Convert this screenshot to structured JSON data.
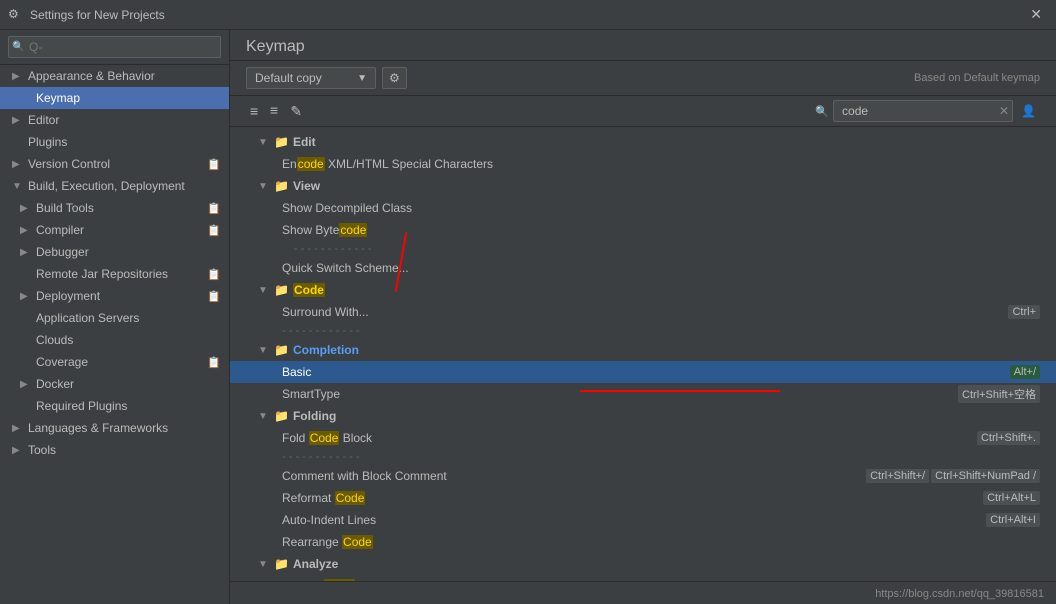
{
  "titleBar": {
    "icon": "⚙",
    "title": "Settings for New Projects",
    "closeLabel": "✕"
  },
  "sidebar": {
    "searchPlaceholder": "Q-",
    "items": [
      {
        "id": "appearance",
        "label": "Appearance & Behavior",
        "indent": 0,
        "type": "section",
        "arrow": "▶",
        "hasArrow": true
      },
      {
        "id": "keymap",
        "label": "Keymap",
        "indent": 1,
        "type": "item",
        "active": true
      },
      {
        "id": "editor",
        "label": "Editor",
        "indent": 0,
        "type": "section",
        "arrow": "▶",
        "hasArrow": true
      },
      {
        "id": "plugins",
        "label": "Plugins",
        "indent": 0,
        "type": "item"
      },
      {
        "id": "version-control",
        "label": "Version Control",
        "indent": 0,
        "type": "section",
        "arrow": "▶",
        "hasArrow": true,
        "hasCopyIcon": true
      },
      {
        "id": "build-execution",
        "label": "Build, Execution, Deployment",
        "indent": 0,
        "type": "section",
        "arrow": "▼",
        "hasArrow": true
      },
      {
        "id": "build-tools",
        "label": "Build Tools",
        "indent": 1,
        "type": "section",
        "arrow": "▶",
        "hasArrow": true,
        "hasCopyIcon": true
      },
      {
        "id": "compiler",
        "label": "Compiler",
        "indent": 1,
        "type": "section",
        "arrow": "▶",
        "hasArrow": true,
        "hasCopyIcon": true
      },
      {
        "id": "debugger",
        "label": "Debugger",
        "indent": 1,
        "type": "section",
        "arrow": "▶",
        "hasArrow": true
      },
      {
        "id": "remote-jar",
        "label": "Remote Jar Repositories",
        "indent": 1,
        "type": "item",
        "hasCopyIcon": true
      },
      {
        "id": "deployment",
        "label": "Deployment",
        "indent": 1,
        "type": "section",
        "arrow": "▶",
        "hasArrow": true,
        "hasCopyIcon": true
      },
      {
        "id": "app-servers",
        "label": "Application Servers",
        "indent": 1,
        "type": "item"
      },
      {
        "id": "clouds",
        "label": "Clouds",
        "indent": 1,
        "type": "item"
      },
      {
        "id": "coverage",
        "label": "Coverage",
        "indent": 1,
        "type": "item",
        "hasCopyIcon": true
      },
      {
        "id": "docker",
        "label": "Docker",
        "indent": 1,
        "type": "section",
        "arrow": "▶",
        "hasArrow": true
      },
      {
        "id": "required-plugins",
        "label": "Required Plugins",
        "indent": 1,
        "type": "item"
      },
      {
        "id": "languages",
        "label": "Languages & Frameworks",
        "indent": 0,
        "type": "section",
        "arrow": "▶",
        "hasArrow": true
      },
      {
        "id": "tools",
        "label": "Tools",
        "indent": 0,
        "type": "section",
        "arrow": "▶",
        "hasArrow": true
      }
    ]
  },
  "panel": {
    "title": "Keymap",
    "keymapDropdown": "Default copy",
    "gearIcon": "⚙",
    "basedOn": "Based on Default keymap",
    "searchValue": "code",
    "toolbar": {
      "collapseAll": "≡",
      "expandAll": "≡",
      "edit": "✎"
    }
  },
  "keymapItems": [
    {
      "id": "edit-group",
      "label": "Edit",
      "indent": 1,
      "type": "group",
      "arrow": "▼",
      "hasFolder": true
    },
    {
      "id": "encode-xml",
      "label": "EnCode XML/HTML Special Characters",
      "indent": 2,
      "type": "item",
      "highlight": "code",
      "highlightPos": 2
    },
    {
      "id": "view-group",
      "label": "View",
      "indent": 1,
      "type": "group",
      "arrow": "▼",
      "hasFolder": true
    },
    {
      "id": "show-decompiled",
      "label": "Show Decompiled Class",
      "indent": 2,
      "type": "item"
    },
    {
      "id": "show-bytecode",
      "label": "Show ByteCode",
      "indent": 2,
      "type": "item",
      "highlight": "code",
      "labelParts": [
        "Show Byte",
        "code"
      ]
    },
    {
      "id": "divider1",
      "type": "divider",
      "label": "- - - - - - - - - - - -",
      "indent": 2
    },
    {
      "id": "quick-switch",
      "label": "Quick Switch Scheme...",
      "indent": 2,
      "type": "item"
    },
    {
      "id": "code-group",
      "label": "Code",
      "indent": 1,
      "type": "group",
      "arrow": "▼",
      "hasFolder": true,
      "labelHighlight": "Code"
    },
    {
      "id": "surround-with",
      "label": "Surround With...",
      "indent": 2,
      "type": "item",
      "shortcut": "Ctrl+"
    },
    {
      "id": "divider2",
      "type": "divider",
      "label": "- - - - - - - - - - - -",
      "indent": 2
    },
    {
      "id": "completion-group",
      "label": "Completion",
      "indent": 1,
      "type": "group",
      "arrow": "▼",
      "hasFolder": true,
      "labelColor": "blue"
    },
    {
      "id": "basic",
      "label": "Basic",
      "indent": 2,
      "type": "item",
      "selected": true,
      "shortcut": "Alt+/"
    },
    {
      "id": "smarttype",
      "label": "SmartType",
      "indent": 2,
      "type": "item",
      "shortcut": "Ctrl+Shift+空格"
    },
    {
      "id": "folding-group",
      "label": "Folding",
      "indent": 1,
      "type": "group",
      "arrow": "▼",
      "hasFolder": true
    },
    {
      "id": "fold-code-block",
      "label": "Fold Code Block",
      "indent": 2,
      "type": "item",
      "highlight": "Code",
      "labelParts": [
        "Fold ",
        "Code",
        " Block"
      ],
      "shortcut": "Ctrl+Shift+."
    },
    {
      "id": "divider3",
      "type": "divider",
      "label": "- - - - - - - - - - - -",
      "indent": 2
    },
    {
      "id": "comment-block",
      "label": "Comment with Block Comment",
      "indent": 2,
      "type": "item",
      "shortcut1": "Ctrl+Shift+/",
      "shortcut2": "Ctrl+Shift+NumPad /"
    },
    {
      "id": "reformat-code",
      "label": "Reformat Code",
      "indent": 2,
      "type": "item",
      "highlight": "Code",
      "labelParts": [
        "Reformat ",
        "Code"
      ],
      "shortcut": "Ctrl+Alt+L"
    },
    {
      "id": "auto-indent",
      "label": "Auto-Indent Lines",
      "indent": 2,
      "type": "item",
      "shortcut": "Ctrl+Alt+I"
    },
    {
      "id": "rearrange-code",
      "label": "Rearrange Code",
      "indent": 2,
      "type": "item",
      "highlight": "Code",
      "labelParts": [
        "Rearrange ",
        "Code"
      ]
    },
    {
      "id": "analyze-group",
      "label": "Analyze",
      "indent": 1,
      "type": "group",
      "arrow": "▼",
      "hasFolder": true
    },
    {
      "id": "inspect-code",
      "label": "Inspect Code",
      "indent": 2,
      "type": "item",
      "labelParts": [
        "Inspect ",
        "Code"
      ]
    }
  ],
  "bottomUrl": "https://blog.csdn.net/qq_39816581"
}
